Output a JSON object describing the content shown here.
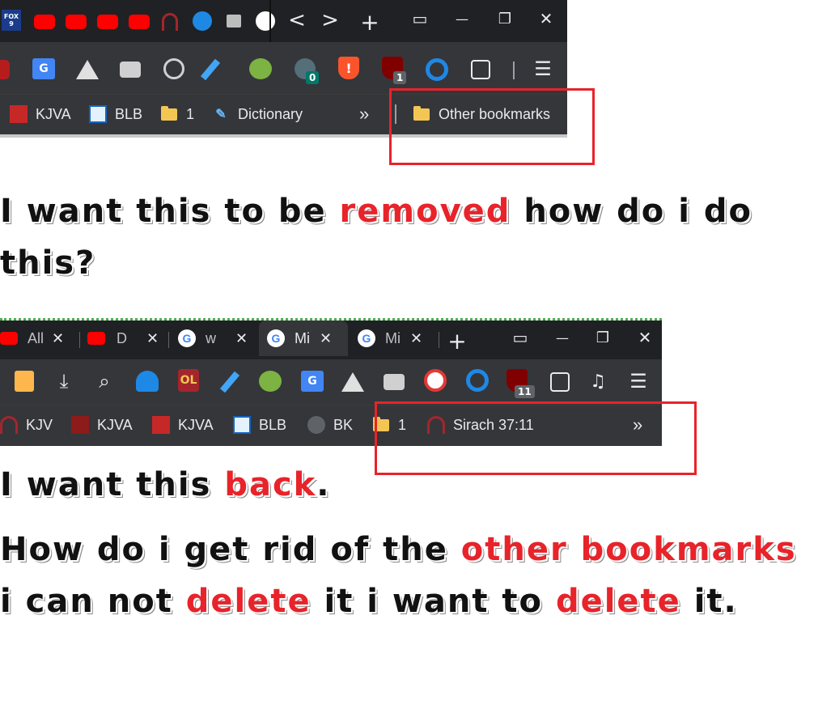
{
  "screenshot1": {
    "tabstrip": {
      "controls": {
        "back": "<",
        "forward": ">",
        "newtab": "+",
        "tabsearch": "▭",
        "minimize": "—",
        "restore": "❐",
        "close": "✕"
      },
      "fox_label": "FOX 9"
    },
    "toolbar": {
      "badge_0": "0",
      "badge_1": "1",
      "menu": "☰"
    },
    "bookmarks": [
      {
        "label": "KJVA"
      },
      {
        "label": "BLB"
      },
      {
        "label": "1"
      },
      {
        "label": "Dictionary"
      }
    ],
    "overflow": "»",
    "other_bookmarks": "Other bookmarks"
  },
  "text1": {
    "line1_pre": "I want this to be ",
    "line1_red": "removed",
    "line1_post": " how do i do",
    "line2": "this?"
  },
  "screenshot2": {
    "tabs": [
      {
        "label": "All"
      },
      {
        "label": "D"
      },
      {
        "label": "w"
      },
      {
        "label": "Mi"
      },
      {
        "label": "Mi"
      }
    ],
    "newtab": "+",
    "badge_11": "11",
    "bookmarks": [
      {
        "label": "KJV"
      },
      {
        "label": "KJVA"
      },
      {
        "label": "KJVA"
      },
      {
        "label": "BLB"
      },
      {
        "label": "BK"
      },
      {
        "label": "1"
      },
      {
        "label": "Sirach 37:11"
      }
    ],
    "overflow": "»"
  },
  "text2": {
    "line1_pre": "I want this ",
    "line1_red": "back",
    "line1_post": ".",
    "line2_pre": "How do i get rid of the ",
    "line2_red": "other bookmarks",
    "line3_pre": "i can not ",
    "line3_red1": "delete",
    "line3_mid": " it i want to ",
    "line3_red2": "delete",
    "line3_post": " it."
  },
  "colors": {
    "accent_red": "#e8232a",
    "chrome_dark": "#202124",
    "chrome_toolbar": "#35363a",
    "text_light": "#e8eaed"
  }
}
